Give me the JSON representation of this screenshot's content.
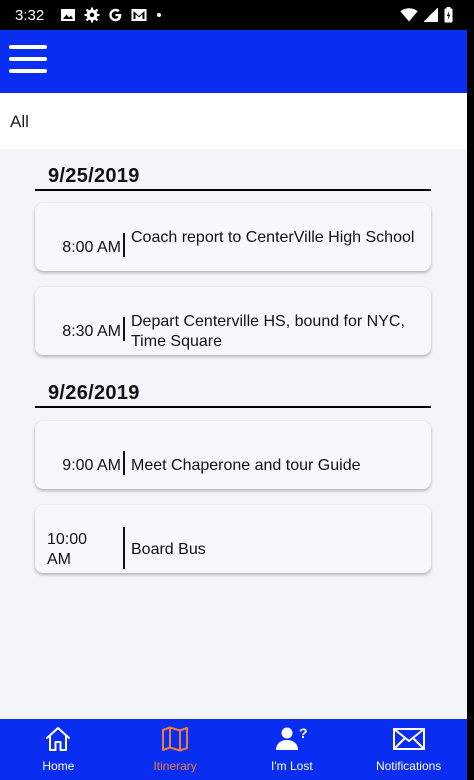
{
  "status_bar": {
    "time": "3:32",
    "icons": [
      "gallery-icon",
      "settings-gear-icon",
      "google-icon",
      "gmail-icon",
      "dot-icon",
      "wifi-icon",
      "signal-icon",
      "battery-icon"
    ]
  },
  "app_bar": {
    "menu_icon": "hamburger-menu-icon",
    "color": "#0a2df2"
  },
  "filter": {
    "label": "All"
  },
  "itinerary": {
    "days": [
      {
        "date": "9/25/2019",
        "events": [
          {
            "time": "8:00 AM",
            "description": "Coach report to CenterVille High School"
          },
          {
            "time": "8:30 AM",
            "description": "Depart Centerville HS, bound for NYC, Time Square"
          }
        ]
      },
      {
        "date": "9/26/2019",
        "events": [
          {
            "time": "9:00 AM",
            "description": "Meet Chaperone and tour Guide"
          },
          {
            "time": "10:00 AM",
            "description": "Board Bus"
          }
        ]
      }
    ]
  },
  "bottom_nav": {
    "active": "Itinerary",
    "active_color": "#f07a3a",
    "items": [
      {
        "label": "Home",
        "icon": "home-icon"
      },
      {
        "label": "Itinerary",
        "icon": "map-icon"
      },
      {
        "label": "I'm Lost",
        "icon": "person-question-icon"
      },
      {
        "label": "Notifications",
        "icon": "envelope-icon"
      }
    ]
  }
}
